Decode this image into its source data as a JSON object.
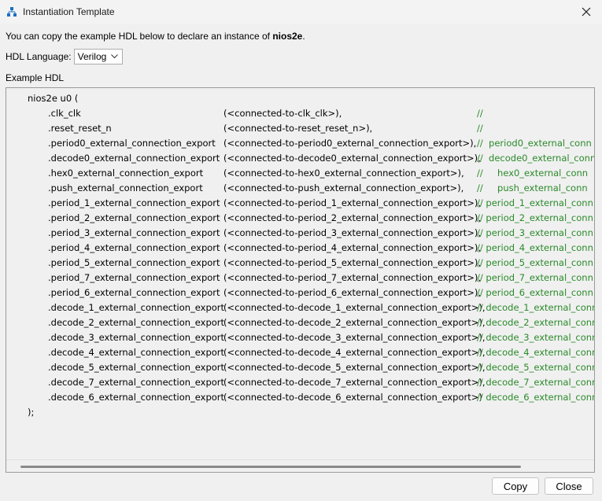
{
  "window": {
    "title": "Instantiation Template",
    "icon": "hierarchy-icon"
  },
  "intro": {
    "text": "You can copy the example HDL below to declare an instance of ",
    "module": "nios2e",
    "period": "."
  },
  "hdl_language": {
    "label": "HDL Language:",
    "value": "Verilog"
  },
  "example_label": "Example HDL",
  "code": {
    "header": "nios2e u0 (",
    "footer": ");",
    "ports": [
      {
        "name": ".clk_clk",
        "conn": "(<connected-to-clk_clk>),",
        "comment": "//"
      },
      {
        "name": ".reset_reset_n",
        "conn": "(<connected-to-reset_reset_n>),",
        "comment": "//"
      },
      {
        "name": ".period0_external_connection_export",
        "conn": "(<connected-to-period0_external_connection_export>),",
        "comment": "//  period0_external_conn"
      },
      {
        "name": ".decode0_external_connection_export",
        "conn": "(<connected-to-decode0_external_connection_export>),",
        "comment": "//  decode0_external_conn"
      },
      {
        "name": ".hex0_external_connection_export",
        "conn": "(<connected-to-hex0_external_connection_export>),",
        "comment": "//     hex0_external_conn"
      },
      {
        "name": ".push_external_connection_export",
        "conn": "(<connected-to-push_external_connection_export>),",
        "comment": "//     push_external_conn"
      },
      {
        "name": ".period_1_external_connection_export",
        "conn": "(<connected-to-period_1_external_connection_export>),",
        "comment": "// period_1_external_conn"
      },
      {
        "name": ".period_2_external_connection_export",
        "conn": "(<connected-to-period_2_external_connection_export>),",
        "comment": "// period_2_external_conn"
      },
      {
        "name": ".period_3_external_connection_export",
        "conn": "(<connected-to-period_3_external_connection_export>),",
        "comment": "// period_3_external_conn"
      },
      {
        "name": ".period_4_external_connection_export",
        "conn": "(<connected-to-period_4_external_connection_export>),",
        "comment": "// period_4_external_conn"
      },
      {
        "name": ".period_5_external_connection_export",
        "conn": "(<connected-to-period_5_external_connection_export>),",
        "comment": "// period_5_external_conn"
      },
      {
        "name": ".period_7_external_connection_export",
        "conn": "(<connected-to-period_7_external_connection_export>),",
        "comment": "// period_7_external_conn"
      },
      {
        "name": ".period_6_external_connection_export",
        "conn": "(<connected-to-period_6_external_connection_export>),",
        "comment": "// period_6_external_conn"
      },
      {
        "name": ".decode_1_external_connection_export",
        "conn": "(<connected-to-decode_1_external_connection_export>),",
        "comment": "// decode_1_external_conn"
      },
      {
        "name": ".decode_2_external_connection_export",
        "conn": "(<connected-to-decode_2_external_connection_export>),",
        "comment": "// decode_2_external_conn"
      },
      {
        "name": ".decode_3_external_connection_export",
        "conn": "(<connected-to-decode_3_external_connection_export>),",
        "comment": "// decode_3_external_conn"
      },
      {
        "name": ".decode_4_external_connection_export",
        "conn": "(<connected-to-decode_4_external_connection_export>),",
        "comment": "// decode_4_external_conn"
      },
      {
        "name": ".decode_5_external_connection_export",
        "conn": "(<connected-to-decode_5_external_connection_export>),",
        "comment": "// decode_5_external_conn"
      },
      {
        "name": ".decode_7_external_connection_export",
        "conn": "(<connected-to-decode_7_external_connection_export>),",
        "comment": "// decode_7_external_conn"
      },
      {
        "name": ".decode_6_external_connection_export",
        "conn": "(<connected-to-decode_6_external_connection_export>)",
        "comment": "// decode_6_external_conn"
      }
    ]
  },
  "buttons": {
    "copy": "Copy",
    "close": "Close"
  },
  "colors": {
    "comment": "#2a8a2a",
    "background": "#f0f0f0",
    "icon_blue": "#1a6fc4"
  }
}
